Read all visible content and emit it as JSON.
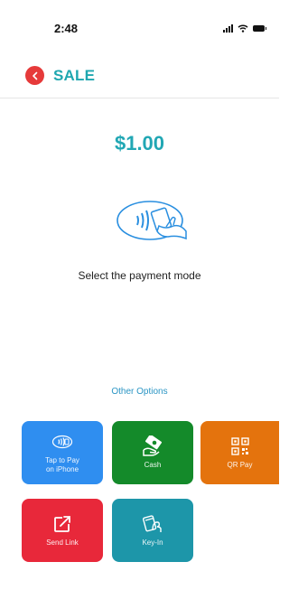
{
  "status_bar": {
    "time": "2:48"
  },
  "header": {
    "title": "SALE"
  },
  "amount": "$1.00",
  "instruction": "Select the payment mode",
  "other_options": "Other Options",
  "tiles": [
    {
      "label": "Tap to Pay\non iPhone",
      "icon": "contactless-card-icon",
      "color": "#2f8ef0"
    },
    {
      "label": "Cash",
      "icon": "cash-icon",
      "color": "#148a2a"
    },
    {
      "label": "QR Pay",
      "icon": "qr-code-icon",
      "color": "#e4730d"
    },
    {
      "label": "Send Link",
      "icon": "send-link-icon",
      "color": "#e8283a"
    },
    {
      "label": "Key-In",
      "icon": "key-in-card-icon",
      "color": "#1d96a9"
    }
  ]
}
